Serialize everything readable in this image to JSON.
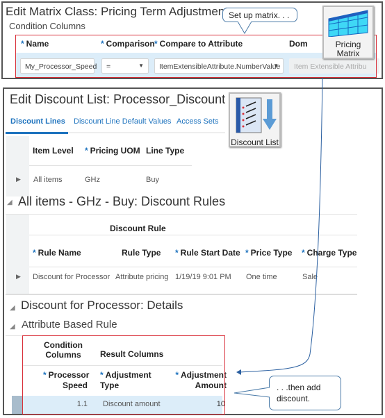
{
  "matrix": {
    "title": "Edit Matrix Class: Pricing Term Adjustment",
    "section": "Condition Columns",
    "headers": [
      "Name",
      "Comparison",
      "Compare to Attribute",
      "Dom"
    ],
    "row": {
      "name": "My_Processor_Speed",
      "comparison": "=",
      "compare_to": "ItemExtensibleAttribute.NumberValue",
      "domain": "Item Extensible Attribu"
    },
    "callout": "Set up matrix. . .",
    "icon_label": "Pricing Matrix"
  },
  "discount": {
    "title": "Edit Discount List: Processor_Discount",
    "tabs": [
      "Discount Lines",
      "Discount Line Default Values",
      "Access Sets"
    ],
    "icon_label": "Discount List",
    "lines": {
      "headers": [
        "Item Level",
        "Pricing UOM",
        "Line Type"
      ],
      "row": [
        "All items",
        "GHz",
        "Buy"
      ]
    },
    "rules": {
      "title": "All items - GHz - Buy: Discount Rules",
      "group": "Discount Rule",
      "headers": [
        "Rule Name",
        "Rule Type",
        "Rule Start Date",
        "Price Type",
        "Charge Type"
      ],
      "row": [
        "Discount for Processor",
        "Attribute pricing",
        "1/19/19 9:01 PM",
        "One time",
        "Sale"
      ]
    },
    "details": {
      "title": "Discount for Processor: Details",
      "subtitle": "Attribute Based Rule",
      "group1": "Condition Columns",
      "group2": "Result Columns",
      "headers": [
        "Processor Speed",
        "Adjustment Type",
        "Adjustment Amount"
      ],
      "row": [
        "1.1",
        "Discount amount",
        "10"
      ]
    },
    "callout": ". . .then add discount."
  },
  "colors": {
    "accent": "#1e73be",
    "highlight": "#dcedf9",
    "annotation": "#d9303a"
  }
}
